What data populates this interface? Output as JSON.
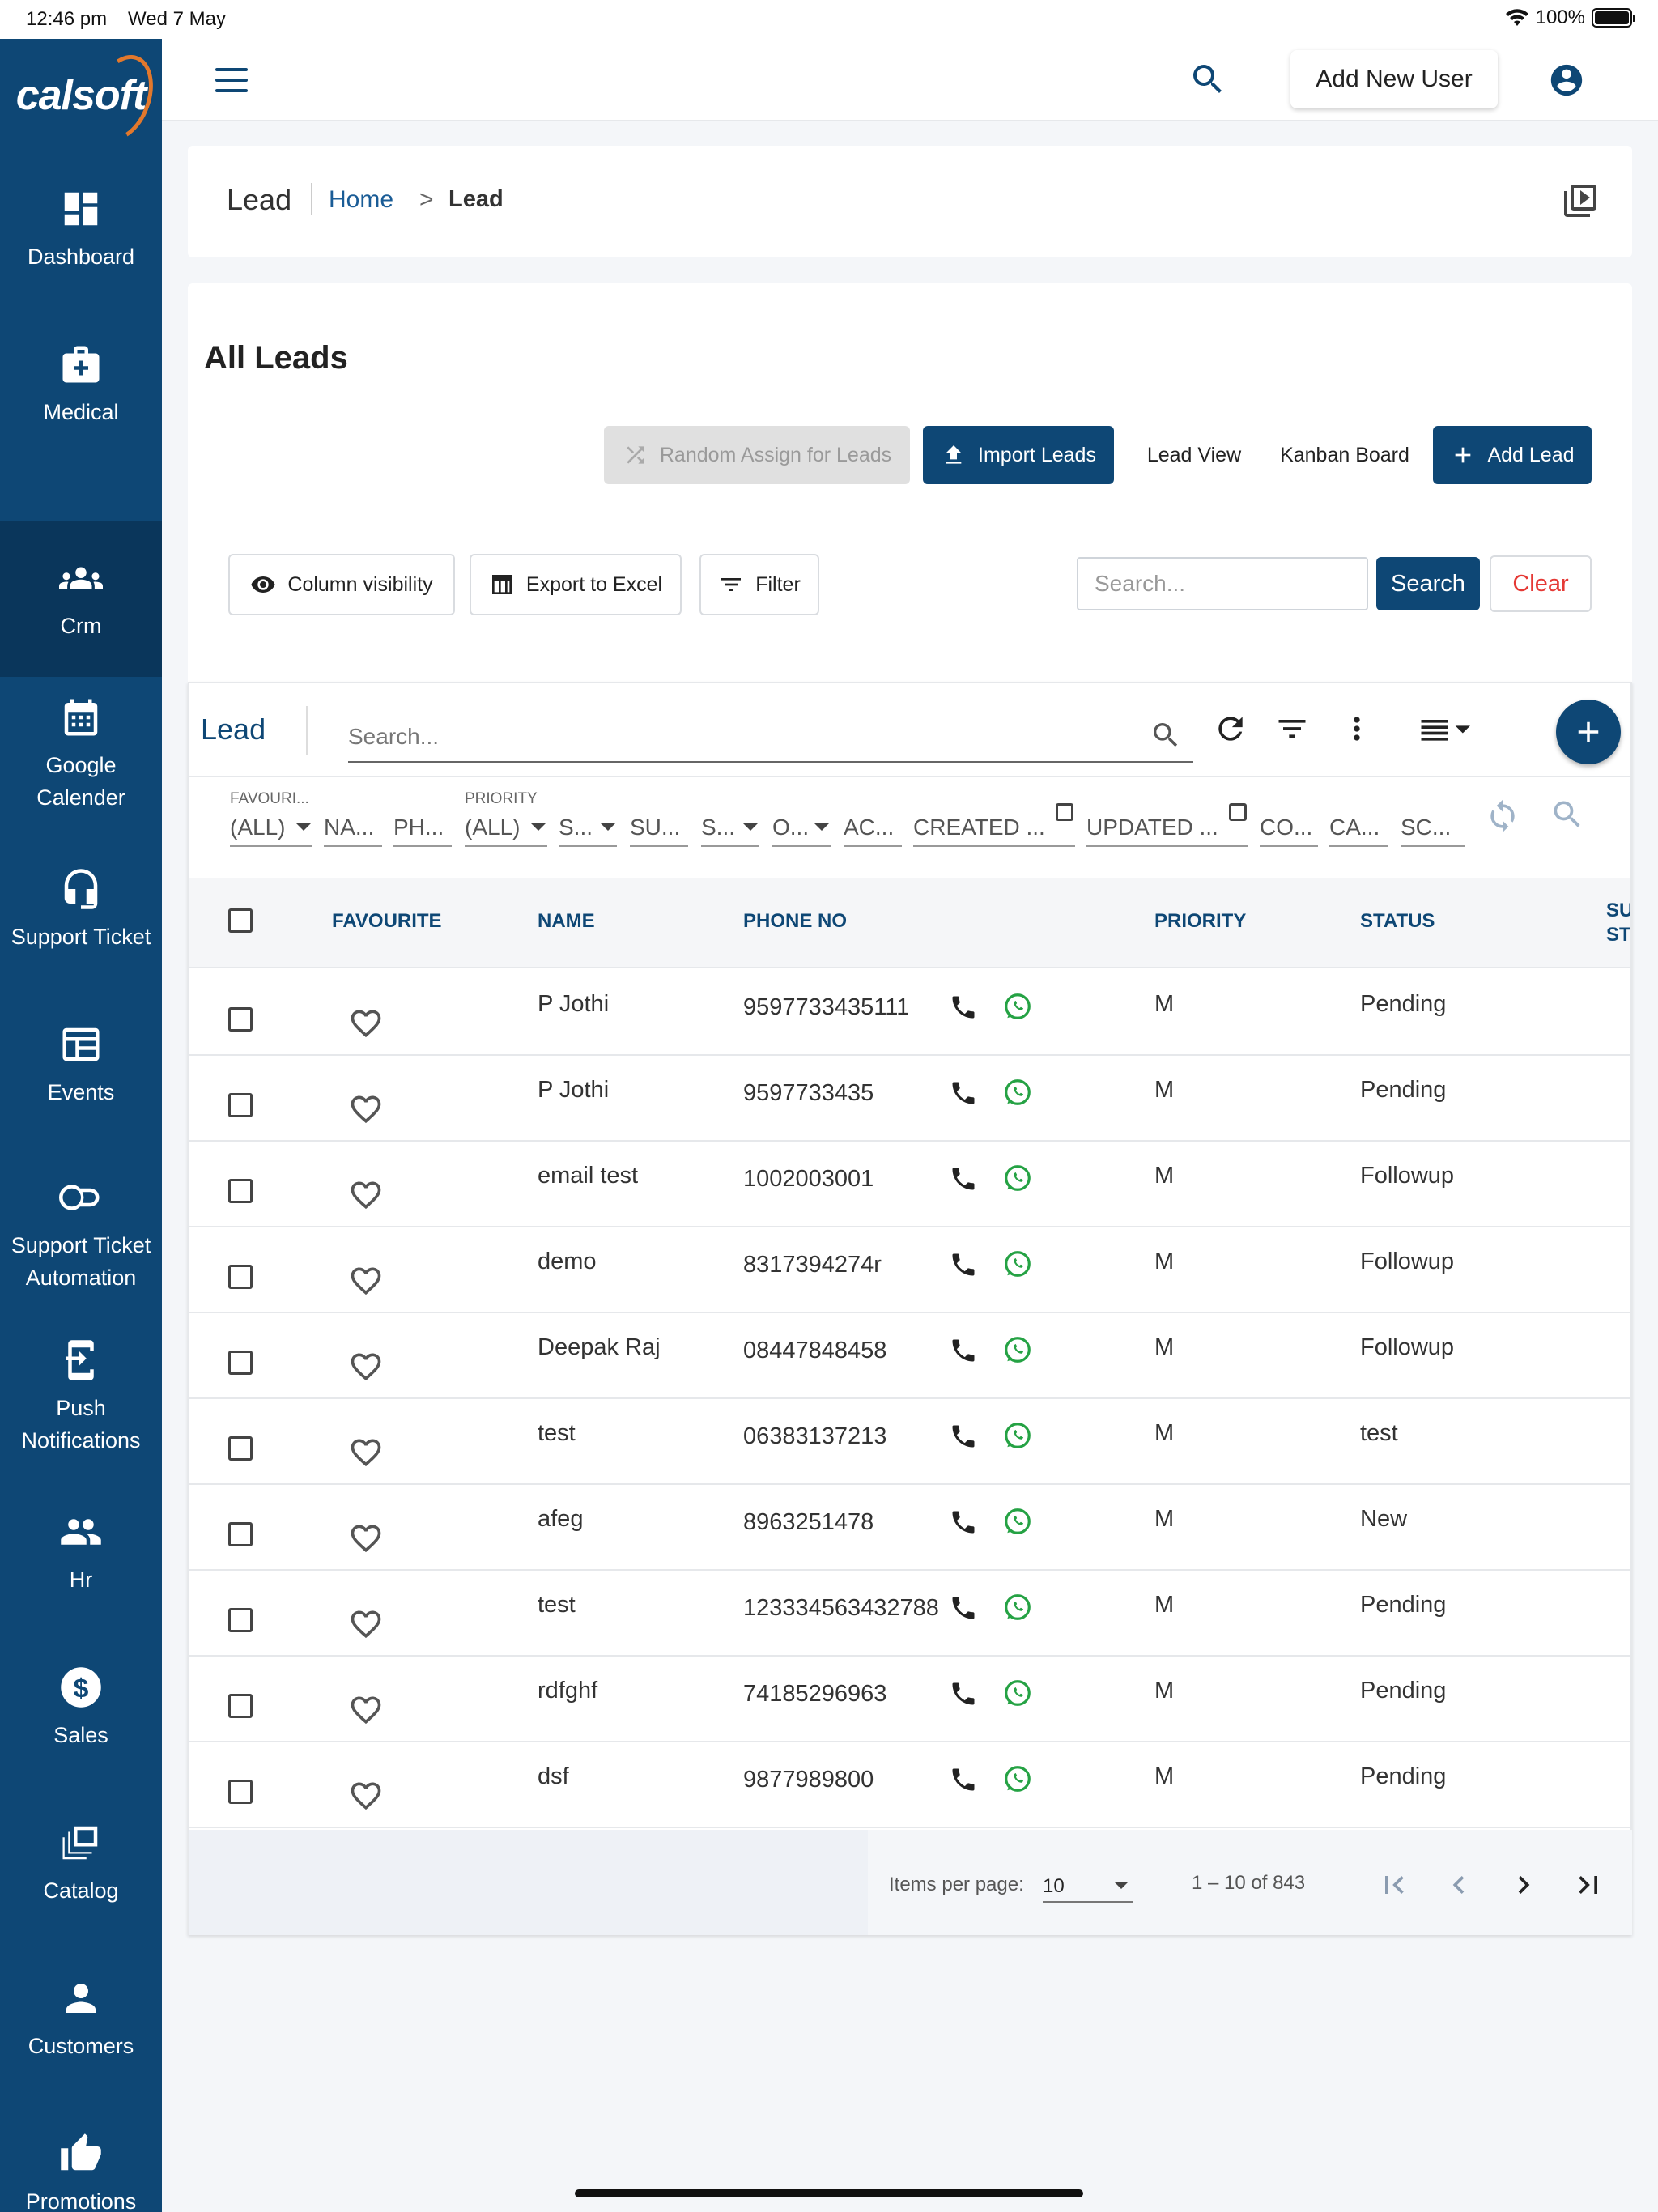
{
  "statusbar": {
    "time": "12:46 pm",
    "date": "Wed 7 May",
    "battery": "100%"
  },
  "logo": {
    "text": "calsoft"
  },
  "sidebar": {
    "items": [
      {
        "label": "Dashboard",
        "icon": "dashboard-icon"
      },
      {
        "label": "Medical",
        "icon": "medical-kit-icon"
      },
      {
        "label": "Crm",
        "icon": "people-icon",
        "active": true
      },
      {
        "label": "Google Calender",
        "icon": "calendar-icon"
      },
      {
        "label": "Support Ticket",
        "icon": "headset-icon"
      },
      {
        "label": "Events",
        "icon": "events-icon"
      },
      {
        "label": "Support Ticket Automation",
        "icon": "toggle-icon"
      },
      {
        "label": "Push Notifications",
        "icon": "push-icon"
      },
      {
        "label": "Hr",
        "icon": "group-icon"
      },
      {
        "label": "Sales",
        "icon": "dollar-icon"
      },
      {
        "label": "Catalog",
        "icon": "catalog-icon"
      },
      {
        "label": "Customers",
        "icon": "person-icon"
      },
      {
        "label": "Promotions",
        "icon": "thumbs-up-icon"
      }
    ]
  },
  "header": {
    "add_user_label": "Add New User"
  },
  "breadcrumb": {
    "title": "Lead",
    "home": "Home",
    "separator": ">",
    "current": "Lead"
  },
  "page": {
    "title": "All Leads"
  },
  "actions": {
    "random_assign": "Random Assign for Leads",
    "import": "Import Leads",
    "lead_view": "Lead View",
    "kanban": "Kanban Board",
    "add_lead": "Add Lead",
    "column_visibility": "Column visibility",
    "export": "Export to Excel",
    "filter": "Filter",
    "search_placeholder": "Search...",
    "search": "Search",
    "clear": "Clear"
  },
  "grid": {
    "title": "Lead",
    "search_placeholder": "Search...",
    "filters": [
      {
        "label": "FAVOURI...",
        "value": "(ALL)",
        "type": "select"
      },
      {
        "label": "",
        "value": "NA...",
        "type": "text"
      },
      {
        "label": "",
        "value": "PH...",
        "type": "text"
      },
      {
        "label": "PRIORITY",
        "value": "(ALL)",
        "type": "select"
      },
      {
        "label": "",
        "value": "S...",
        "type": "select"
      },
      {
        "label": "",
        "value": "SU...",
        "type": "text"
      },
      {
        "label": "",
        "value": "S...",
        "type": "select"
      },
      {
        "label": "",
        "value": "O...",
        "type": "select"
      },
      {
        "label": "",
        "value": "AC...",
        "type": "text"
      },
      {
        "label": "",
        "value": "CREATED ...",
        "type": "date"
      },
      {
        "label": "",
        "value": "UPDATED ...",
        "type": "date"
      },
      {
        "label": "",
        "value": "CO...",
        "type": "text"
      },
      {
        "label": "",
        "value": "CA...",
        "type": "text"
      },
      {
        "label": "",
        "value": "SC...",
        "type": "text"
      }
    ],
    "columns": [
      "FAVOURITE",
      "NAME",
      "PHONE NO",
      "PRIORITY",
      "STATUS",
      "SU ST"
    ],
    "rows": [
      {
        "name": "P Jothi",
        "phone": "9597733435111",
        "priority": "M",
        "status": "Pending"
      },
      {
        "name": "P Jothi",
        "phone": "9597733435",
        "priority": "M",
        "status": "Pending"
      },
      {
        "name": "email test",
        "phone": "1002003001",
        "priority": "M",
        "status": "Followup"
      },
      {
        "name": "demo",
        "phone": "8317394274r",
        "priority": "M",
        "status": "Followup"
      },
      {
        "name": "Deepak Raj",
        "phone": "08447848458",
        "priority": "M",
        "status": "Followup"
      },
      {
        "name": "test",
        "phone": "06383137213",
        "priority": "M",
        "status": "test"
      },
      {
        "name": "afeg",
        "phone": "8963251478",
        "priority": "M",
        "status": "New"
      },
      {
        "name": "test",
        "phone": "123334563432788",
        "priority": "M",
        "status": "Pending"
      },
      {
        "name": "rdfghf",
        "phone": "74185296963",
        "priority": "M",
        "status": "Pending"
      },
      {
        "name": "dsf",
        "phone": "9877989800",
        "priority": "M",
        "status": "Pending"
      }
    ],
    "paginator": {
      "items_per_page_label": "Items per page:",
      "items_per_page": "10",
      "range": "1 – 10 of 843"
    }
  },
  "colors": {
    "primary": "#0e4775",
    "sidebar": "#0e4775",
    "sidebar_active": "#0a365b",
    "whatsapp": "#25a244",
    "clear": "#e53935"
  }
}
